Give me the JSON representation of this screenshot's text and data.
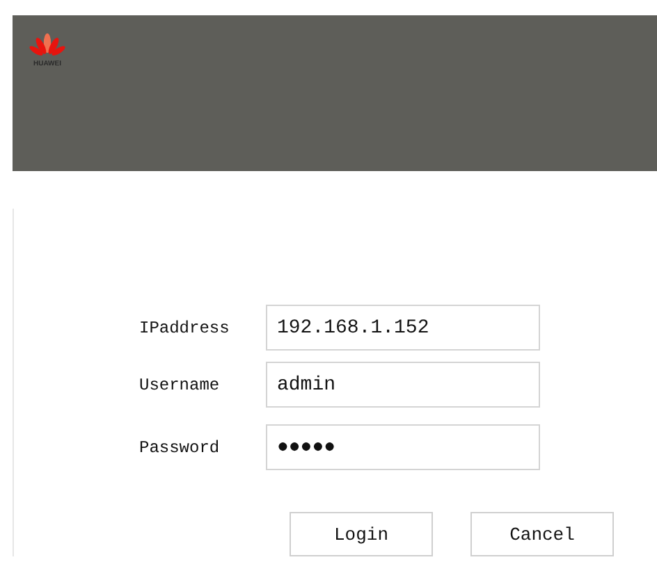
{
  "header": {
    "logo_text": "HUAWEI"
  },
  "fields": [
    {
      "label": "IPaddress",
      "value": "192.168.1.152"
    },
    {
      "label": "Username",
      "value": "admin"
    },
    {
      "label": "Password",
      "value": "●●●●●"
    }
  ],
  "buttons": [
    "Login",
    "Cancel"
  ]
}
